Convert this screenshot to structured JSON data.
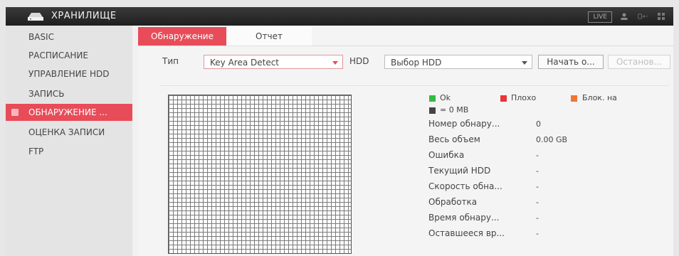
{
  "header": {
    "title": "ХРАНИЛИЩЕ",
    "live_label": "LIVE",
    "icons": [
      "hdd-logo-icon",
      "user-icon",
      "logout-icon",
      "grid-icon"
    ]
  },
  "sidebar": {
    "items": [
      {
        "label": "BASIC",
        "active": false
      },
      {
        "label": "РАСПИСАНИЕ",
        "active": false
      },
      {
        "label": "УПРАВЛЕНИЕ HDD",
        "active": false
      },
      {
        "label": "ЗАПИСЬ",
        "active": false
      },
      {
        "label": "ОБНАРУЖЕНИЕ ...",
        "active": true
      },
      {
        "label": "ОЦЕНКА ЗАПИСИ",
        "active": false
      },
      {
        "label": "FTP",
        "active": false
      }
    ]
  },
  "tabs": [
    {
      "label": "Обнаружение",
      "active": true
    },
    {
      "label": "Отчет",
      "active": false
    }
  ],
  "filters": {
    "type_label": "Тип",
    "type_value": "Key Area Detect",
    "hdd_label": "HDD",
    "hdd_value": "Выбор HDD",
    "start_button": "Начать о...",
    "stop_button": "Останов..."
  },
  "legend": {
    "ok": "Ok",
    "bad": "Плохо",
    "block": "Блок. на",
    "size_note": "= 0 MB",
    "colors": {
      "ok": "#33bb44",
      "bad": "#e8343c",
      "block": "#ee7733",
      "size": "#444444"
    }
  },
  "info": {
    "rows": [
      {
        "label": "Номер обнару...",
        "value": "0"
      },
      {
        "label": "Весь объем",
        "value": "0.00 GB"
      },
      {
        "label": "Ошибка",
        "value": "-"
      },
      {
        "label": "Текущий HDD",
        "value": "-"
      },
      {
        "label": "Скорость обна...",
        "value": "-"
      },
      {
        "label": "Обработка",
        "value": "-"
      },
      {
        "label": "Время обнару...",
        "value": "-"
      },
      {
        "label": "Оставшееся вр...",
        "value": "-"
      }
    ]
  },
  "colors": {
    "accent": "#e84c59",
    "topbar": "#2a2a2a"
  }
}
